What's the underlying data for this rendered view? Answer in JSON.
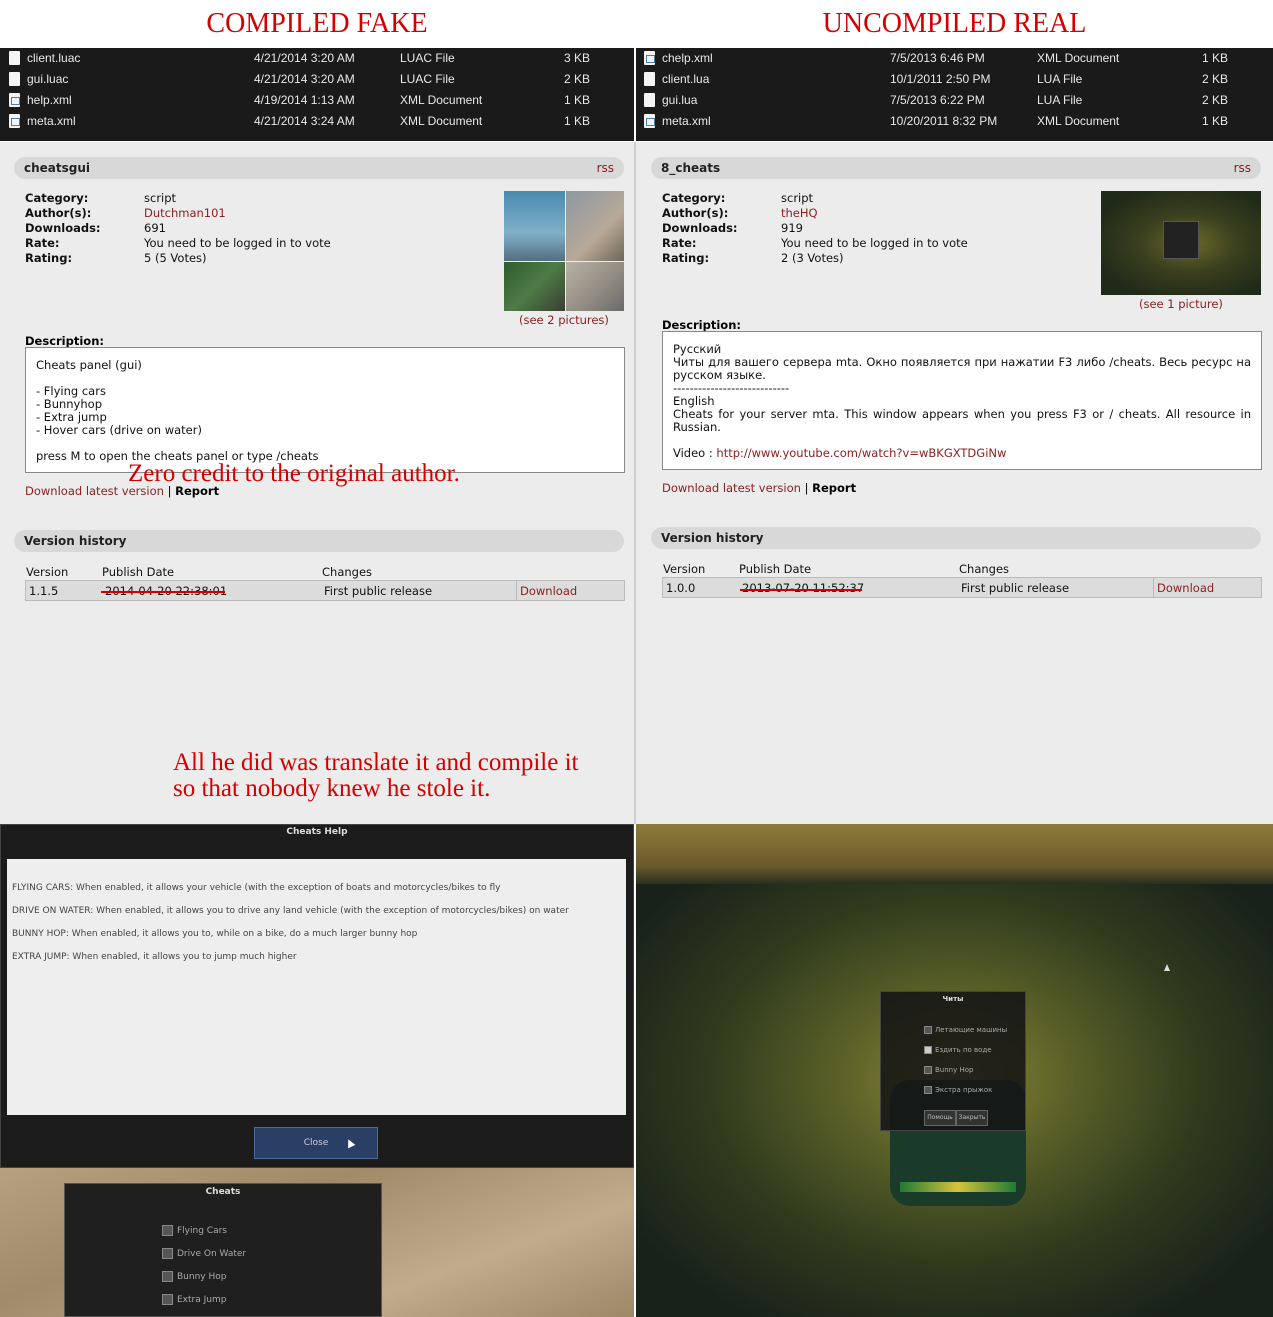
{
  "titles": {
    "left": "COMPILED FAKE",
    "right": "UNCOMPILED REAL"
  },
  "explorer": {
    "left": [
      {
        "name": "client.luac",
        "date": "4/21/2014 3:20 AM",
        "type": "LUAC File",
        "size": "3 KB",
        "icon": "file-icon"
      },
      {
        "name": "gui.luac",
        "date": "4/21/2014 3:20 AM",
        "type": "LUAC File",
        "size": "2 KB",
        "icon": "file-icon"
      },
      {
        "name": "help.xml",
        "date": "4/19/2014 1:13 AM",
        "type": "XML Document",
        "size": "1 KB",
        "icon": "xml-file-icon"
      },
      {
        "name": "meta.xml",
        "date": "4/21/2014 3:24 AM",
        "type": "XML Document",
        "size": "1 KB",
        "icon": "xml-file-icon"
      }
    ],
    "right": [
      {
        "name": "chelp.xml",
        "date": "7/5/2013 6:46 PM",
        "type": "XML Document",
        "size": "1 KB",
        "icon": "xml-file-icon"
      },
      {
        "name": "client.lua",
        "date": "10/1/2011 2:50 PM",
        "type": "LUA File",
        "size": "2 KB",
        "icon": "file-icon"
      },
      {
        "name": "gui.lua",
        "date": "7/5/2013 6:22 PM",
        "type": "LUA File",
        "size": "2 KB",
        "icon": "file-icon"
      },
      {
        "name": "meta.xml",
        "date": "10/20/2011 8:32 PM",
        "type": "XML Document",
        "size": "1 KB",
        "icon": "xml-file-icon"
      }
    ]
  },
  "left": {
    "name": "cheatsgui",
    "rss": "rss",
    "labels": {
      "category": "Category:",
      "authors": "Author(s):",
      "downloads": "Downloads:",
      "rate": "Rate:",
      "rating": "Rating:"
    },
    "category": "script",
    "author": "Dutchman101",
    "downloads": "691",
    "rate": "You need to be logged in to vote",
    "rating": "5 (5 Votes)",
    "pictures": "(see 2 pictures)",
    "desc_label": "Description:",
    "desc": [
      "Cheats panel (gui)",
      "",
      "- Flying cars",
      "- Bunnyhop",
      "- Extra jump",
      "- Hover cars (drive on water)",
      "",
      "press M to open the cheats panel or type /cheats"
    ],
    "download_latest": "Download latest version",
    "sep": "|",
    "report": "Report",
    "version_history": "Version history",
    "cols": {
      "version": "Version",
      "date": "Publish Date",
      "changes": "Changes"
    },
    "row": {
      "version": "1.1.5",
      "date": "2014-04-20 22:38:01",
      "changes": "First public release",
      "download": "Download"
    }
  },
  "right": {
    "name": "8_cheats",
    "rss": "rss",
    "labels": {
      "category": "Category:",
      "authors": "Author(s):",
      "downloads": "Downloads:",
      "rate": "Rate:",
      "rating": "Rating:"
    },
    "category": "script",
    "author": "theHQ",
    "downloads": "919",
    "rate": "You need to be logged in to vote",
    "rating": "2 (3 Votes)",
    "pictures": "(see 1 picture)",
    "desc_label": "Description:",
    "desc": [
      "Русский",
      "Читы для вашего сервера mta. Окно появляется при нажатии F3 либо /cheats. Весь ресурс на русском языке.",
      "----------------------------",
      "English",
      "Cheats for your server mta. This window appears when you press F3 or / cheats. All resource in Russian."
    ],
    "video_label": "Video :",
    "video_url": "http://www.youtube.com/watch?v=wBKGXTDGiNw",
    "download_latest": "Download latest version",
    "sep": "|",
    "report": "Report",
    "version_history": "Version history",
    "cols": {
      "version": "Version",
      "date": "Publish Date",
      "changes": "Changes"
    },
    "row": {
      "version": "1.0.0",
      "date": "2013-07-20 11:52:37",
      "changes": "First public release",
      "download": "Download"
    }
  },
  "notes": {
    "credit": "Zero credit to the original author.",
    "stole_1": "All he did was translate it and compile it",
    "stole_2": "so that nobody knew he stole it."
  },
  "game_left": {
    "help_title": "Cheats Help",
    "help_lines": [
      "FLYING CARS: When enabled, it allows your vehicle (with the exception of boats and motorcycles/bikes to fly",
      "DRIVE ON WATER: When enabled, it allows you to drive any land vehicle (with the exception of motorcycles/bikes) on water",
      "BUNNY HOP: When enabled, it allows you to, while on a bike, do a much larger bunny hop",
      "EXTRA JUMP: When enabled, it allows you to jump much higher"
    ],
    "close": "Close",
    "cheats_title": "Cheats",
    "cheats": [
      "Flying Cars",
      "Drive On Water",
      "Bunny Hop",
      "Extra Jump"
    ]
  },
  "game_right": {
    "title": "Читы",
    "options": [
      "Летающие машины",
      "Ездить по воде",
      "Bunny Hop",
      "Экстра прыжок"
    ],
    "help_btn": "Помощь",
    "close_btn": "Закрыть"
  }
}
